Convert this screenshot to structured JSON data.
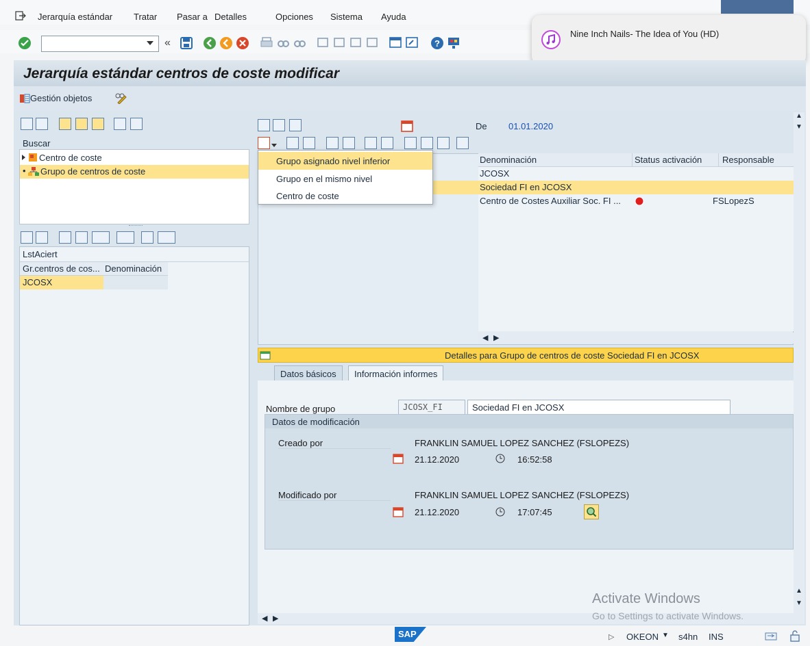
{
  "menu": {
    "items": [
      "Jerarquía estándar",
      "Tratar",
      "Pasar a",
      "Detalles",
      "Opciones",
      "Sistema",
      "Ayuda"
    ]
  },
  "toolbar": {
    "command_value": ""
  },
  "notification": {
    "text": "Nine Inch Nails- The Idea of You (HD)"
  },
  "title": "Jerarquía estándar centros de coste modificar",
  "app_toolbar": {
    "gestion": "Gestión objetos"
  },
  "left": {
    "search_header": "Buscar",
    "tree": [
      {
        "label": "Centro de coste"
      },
      {
        "label": "Grupo de centros de coste"
      }
    ],
    "list_title": "LstAciert",
    "list_headers": [
      "Gr.centros de cos...",
      "Denominación"
    ],
    "list_rows": [
      {
        "group": "JCOSX",
        "denom": ""
      }
    ]
  },
  "right": {
    "de_label": "De",
    "de_value": "01.01.2020",
    "grid_headers": [
      "Denominación",
      "Status activación",
      "Responsable"
    ],
    "grid_rows": [
      {
        "denom": "JCOSX",
        "status": "",
        "resp": ""
      },
      {
        "denom": "Sociedad FI en JCOSX",
        "status": "",
        "resp": ""
      },
      {
        "denom": "Centro de Costes Auxiliar Soc. FI ...",
        "status": "red",
        "resp": "FSLopezS"
      }
    ],
    "dropdown": [
      "Grupo asignado nivel inferior",
      "Grupo en el mismo nivel",
      "Centro de coste"
    ]
  },
  "detail": {
    "header": "Detalles para Grupo de centros de coste Sociedad FI en JCOSX",
    "tabs": [
      "Datos básicos",
      "Información informes"
    ],
    "nombre_label": "Nombre de grupo",
    "group_id": "JCOSX_FI",
    "group_name": "Sociedad FI en JCOSX",
    "section_title": "Datos de modificación",
    "creado_label": "Creado por",
    "creado_user": "FRANKLIN SAMUEL LOPEZ SANCHEZ (FSLOPEZS)",
    "creado_date": "21.12.2020",
    "creado_time": "16:52:58",
    "modificado_label": "Modificado por",
    "modificado_user": "FRANKLIN SAMUEL LOPEZ SANCHEZ (FSLOPEZS)",
    "modificado_date": "21.12.2020",
    "modificado_time": "17:07:45"
  },
  "watermark": {
    "line1": "Activate Windows",
    "line2": "Go to Settings to activate Windows."
  },
  "status": {
    "brand": "SAP",
    "system": "OKEON",
    "server": "s4hn",
    "mode": "INS"
  },
  "colors": {
    "accent": "#fcd34a",
    "selected": "#fde38e",
    "brand": "#1a73c8"
  }
}
